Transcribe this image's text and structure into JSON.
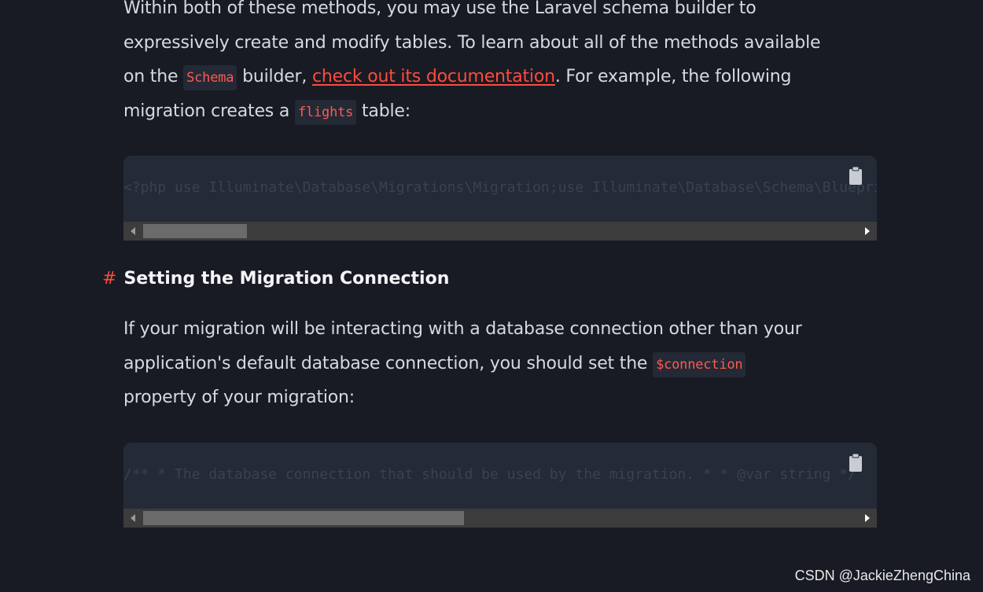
{
  "intro": {
    "line1": "Within both of these methods, you may use the Laravel schema builder to",
    "line2": "expressively create and modify tables. To learn about all of the methods available",
    "line3_pre": "on the ",
    "line3_code": "Schema",
    "line3_mid": " builder, ",
    "line3_link": "check out its documentation",
    "line3_post": ". For example, the following",
    "line4_pre": "migration creates a ",
    "line4_code": "flights",
    "line4_post": " table:"
  },
  "code1": {
    "text": "<?php use Illuminate\\Database\\Migrations\\Migration;use Illuminate\\Database\\Schema\\Blueprint;",
    "copy_icon": "clipboard-icon",
    "scroll_fraction": 0.15
  },
  "section": {
    "hash": "#",
    "title": "Setting the Migration Connection"
  },
  "para2": {
    "line1": "If your migration will be interacting with a database connection other than your",
    "line2_pre": "application's default database connection, you should set the ",
    "line2_code": "$connection",
    "line3": "property of your migration:"
  },
  "code2": {
    "text": "/** * The database connection that should be used by the migration. * * @var string */",
    "copy_icon": "clipboard-icon",
    "scroll_fraction": 0.45
  },
  "watermark": "CSDN @JackieZhengChina",
  "colors": {
    "background": "#181b24",
    "accent": "#ff4a3d",
    "code_bg": "#252a37"
  }
}
